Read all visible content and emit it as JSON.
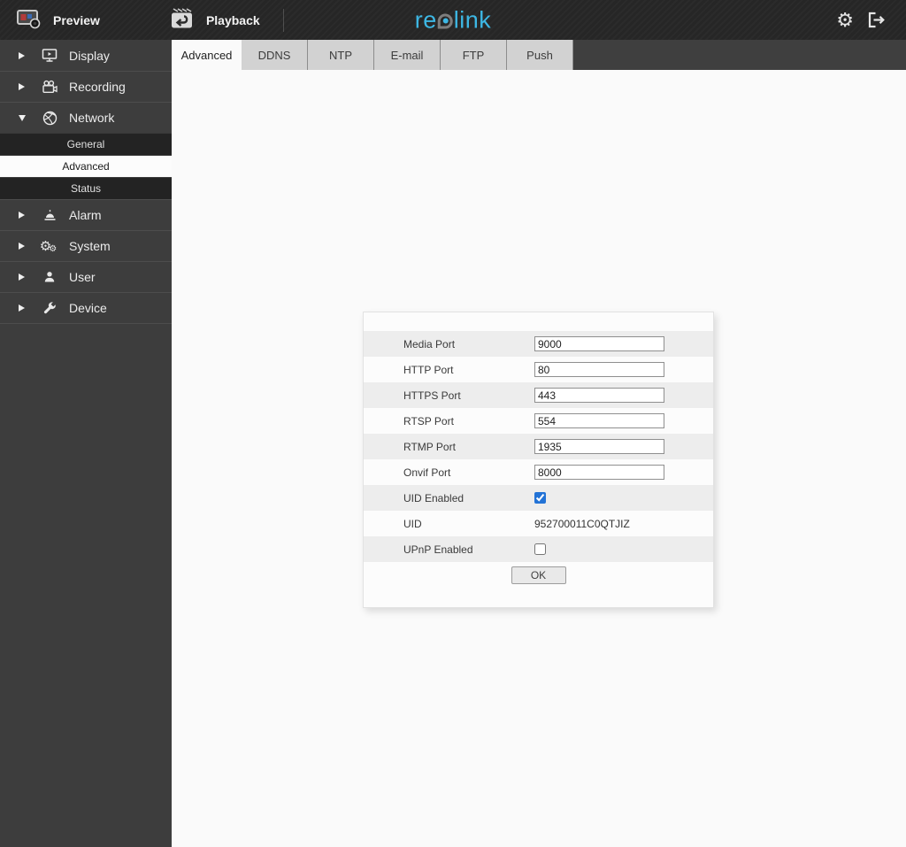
{
  "topbar": {
    "preview_label": "Preview",
    "playback_label": "Playback",
    "logo": {
      "part1": "re",
      "part2": "link"
    }
  },
  "colors": {
    "logo_accent": "#3db7e4",
    "checkbox_checked": "#2373d6",
    "topbar_bg": "#262626",
    "sidebar_bg": "#3d3d3d",
    "tab_inactive_bg": "#d2d2d2",
    "row_stripe": "#ededed"
  },
  "icons": [
    "preview-monitor-icon",
    "playback-clapper-icon",
    "gear-icon",
    "logout-icon",
    "display-icon",
    "recording-icon",
    "network-icon",
    "alarm-icon",
    "system-icon",
    "user-icon",
    "device-icon",
    "chevron-right-icon",
    "chevron-down-icon"
  ],
  "sidebar": {
    "items": [
      {
        "label": "Display",
        "expanded": false
      },
      {
        "label": "Recording",
        "expanded": false
      },
      {
        "label": "Network",
        "expanded": true,
        "children": [
          {
            "label": "General",
            "active": false
          },
          {
            "label": "Advanced",
            "active": true
          },
          {
            "label": "Status",
            "active": false
          }
        ]
      },
      {
        "label": "Alarm",
        "expanded": false
      },
      {
        "label": "System",
        "expanded": false
      },
      {
        "label": "User",
        "expanded": false
      },
      {
        "label": "Device",
        "expanded": false
      }
    ]
  },
  "tabs": [
    {
      "label": "Advanced",
      "active": true
    },
    {
      "label": "DDNS",
      "active": false
    },
    {
      "label": "NTP",
      "active": false
    },
    {
      "label": "E-mail",
      "active": false
    },
    {
      "label": "FTP",
      "active": false
    },
    {
      "label": "Push",
      "active": false
    }
  ],
  "form": {
    "rows": [
      {
        "label": "Media Port",
        "type": "input",
        "value": "9000"
      },
      {
        "label": "HTTP Port",
        "type": "input",
        "value": "80"
      },
      {
        "label": "HTTPS Port",
        "type": "input",
        "value": "443"
      },
      {
        "label": "RTSP Port",
        "type": "input",
        "value": "554"
      },
      {
        "label": "RTMP Port",
        "type": "input",
        "value": "1935"
      },
      {
        "label": "Onvif Port",
        "type": "input",
        "value": "8000"
      },
      {
        "label": "UID Enabled",
        "type": "checkbox",
        "checked": true
      },
      {
        "label": "UID",
        "type": "text",
        "value": "952700011C0QTJIZ"
      },
      {
        "label": "UPnP Enabled",
        "type": "checkbox",
        "checked": false
      }
    ],
    "ok_label": "OK"
  }
}
